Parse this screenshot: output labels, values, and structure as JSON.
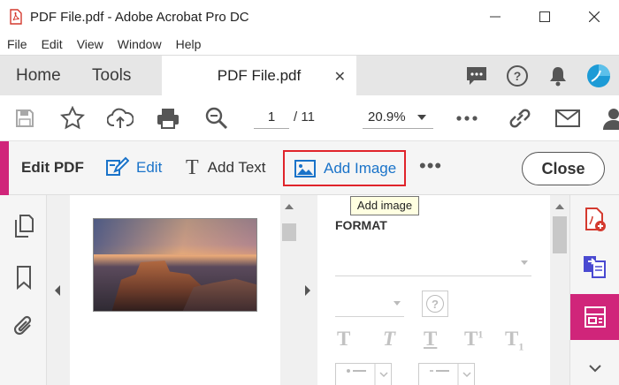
{
  "window": {
    "title": "PDF File.pdf - Adobe Acrobat Pro DC"
  },
  "menu": [
    "File",
    "Edit",
    "View",
    "Window",
    "Help"
  ],
  "tabs": {
    "home": "Home",
    "tools": "Tools",
    "document": "PDF File.pdf"
  },
  "toolbar": {
    "page_current": "1",
    "page_total": "/ 11",
    "zoom": "20.9%"
  },
  "editbar": {
    "title": "Edit PDF",
    "edit_label": "Edit",
    "add_text_label": "Add Text",
    "add_text_glyph": "T",
    "add_image_label": "Add Image",
    "more": "•••",
    "close_label": "Close"
  },
  "tooltip": "Add image",
  "format_panel": {
    "heading": "FORMAT",
    "help_glyph": "?",
    "text_styles": [
      "T",
      "T",
      "T",
      "T",
      "T"
    ],
    "superscript": "1",
    "subscript": "1"
  },
  "colors": {
    "accent_pink": "#d0257a",
    "link_blue": "#1a73c9",
    "highlight_red": "#e0242b",
    "tooltip_bg": "#ffffe1"
  }
}
